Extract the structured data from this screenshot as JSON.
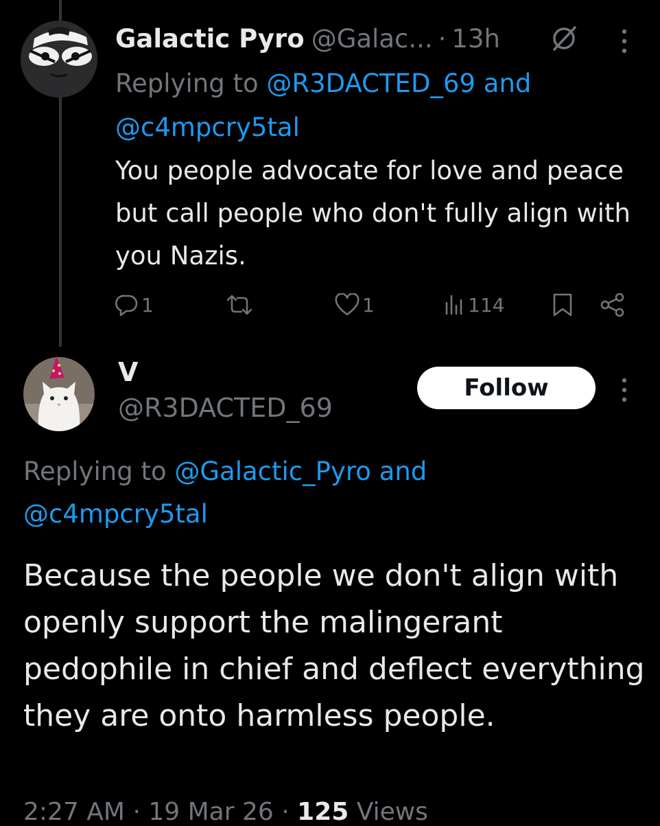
{
  "parent_tweet": {
    "display_name": "Galactic Pyro",
    "handle": "@Galac...",
    "separator": "·",
    "time": "13h",
    "replying_label": "Replying to",
    "mention1": "@R3DACTED_69",
    "conj": "and",
    "mention2": "@c4mpcry5tal",
    "text": "You people advocate for love and peace but call people who don't fully align with you Nazis.",
    "replies": "1",
    "likes": "1",
    "views": "114",
    "icons": [
      "grok-icon",
      "more-icon",
      "reply-icon",
      "retweet-icon",
      "like-icon",
      "views-icon",
      "bookmark-icon",
      "share-icon"
    ]
  },
  "main_tweet": {
    "display_name": "V",
    "handle": "@R3DACTED_69",
    "follow_label": "Follow",
    "replying_label": "Replying to",
    "mention1": "@Galactic_Pyro",
    "conj": "and",
    "mention2": "@c4mpcry5tal",
    "text": "Because the people we don't align with openly support the malingerant pedophile in chief and deflect everything they are onto harmless people.",
    "time": "2:27 AM",
    "sep": "·",
    "date": "19 Mar 26",
    "views_count": "125",
    "views_label": "Views"
  },
  "colors": {
    "background": "#000000",
    "text": "#e7e9ea",
    "secondary": "#71767b",
    "link": "#1d9bf0",
    "button_bg": "#ffffff"
  }
}
